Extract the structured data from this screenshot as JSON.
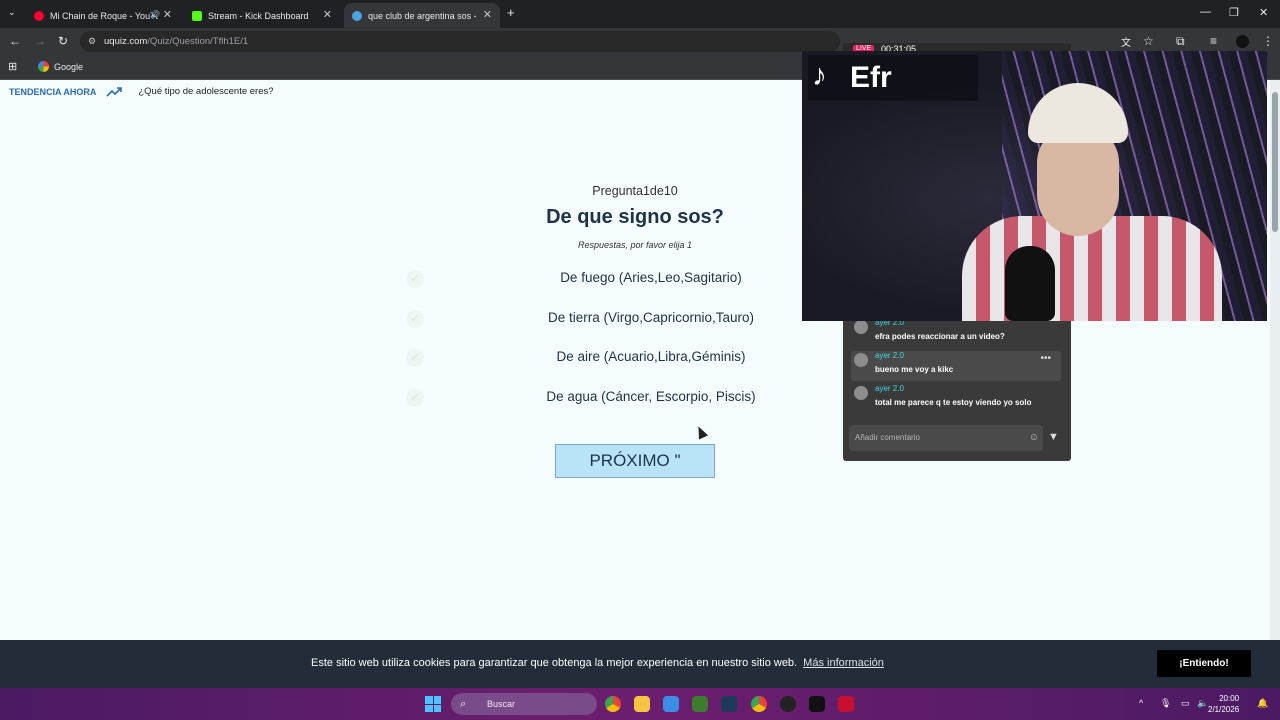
{
  "browser": {
    "tabs": [
      {
        "label": "Mi Chain de Roque - YouTube",
        "icon_color": "#ff0033",
        "active": false
      },
      {
        "label": "Stream - Kick Dashboard",
        "icon_color": "#53fc18",
        "active": false
      },
      {
        "label": "que club de argentina sos - Test",
        "icon_color": "#4aa3df",
        "active": true
      }
    ],
    "new_tab": "+",
    "window_controls": {
      "minimize": "—",
      "maximize": "❐",
      "close": "✕"
    },
    "url_host": "uquiz.com",
    "url_path": "/Quiz/Question/Tflh1E/1",
    "bookmark": "Google"
  },
  "page": {
    "trending_label": "TENDENCIA AHORA",
    "trending_item": "¿Qué tipo de adolescente eres?",
    "question_counter": "Pregunta1de10",
    "question_title": "De que signo sos?",
    "answer_hint": "Respuestas, por favor elija 1",
    "answers": [
      "De fuego (Aries,Leo,Sagitario)",
      "De tierra (Virgo,Capricornio,Tauro)",
      "De aire (Acuario,Libra,Géminis)",
      "De agua (Cáncer, Escorpio, Piscis)"
    ],
    "next_button": "PRÓXIMO \""
  },
  "cookie_bar": {
    "text": "Este sitio web utiliza cookies para garantizar que obtenga la mejor experiencia en nuestro sitio web.",
    "link": "Más información",
    "button": "¡Entiendo!"
  },
  "overlay": {
    "live_badge": "LIVE",
    "live_time": "00:31:05",
    "tiktok_name": "Efr",
    "chat": [
      {
        "user": "ayer 2.0",
        "text": "efra podes reaccionar a un video?"
      },
      {
        "user": "ayer 2.0",
        "text": "bueno me voy a kikc"
      },
      {
        "user": "ayer 2.0",
        "text": "total me parece q te estoy viendo yo solo"
      }
    ],
    "chat_input_placeholder": "Añadir comentario"
  },
  "taskbar": {
    "search_placeholder": "Buscar",
    "clock_time": "20:00",
    "clock_date": "2/1/2026"
  }
}
